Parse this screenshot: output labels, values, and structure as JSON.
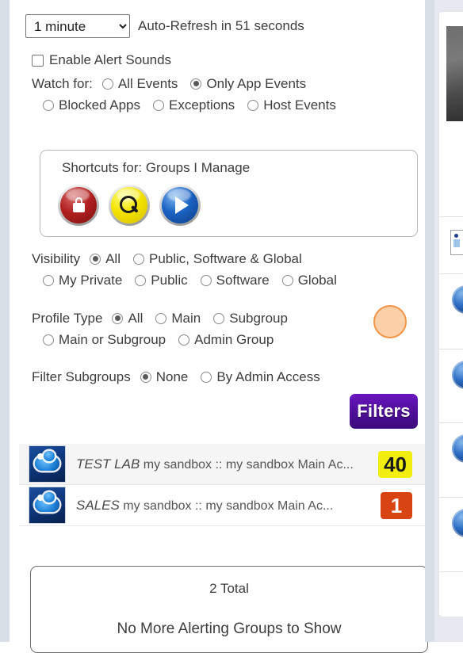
{
  "toolbar": {
    "refresh_interval": "1 minute",
    "refresh_options": [
      "1 minute"
    ],
    "auto_refresh_text": "Auto-Refresh in 51 seconds"
  },
  "alerts": {
    "enable_sounds_label": "Enable Alert Sounds",
    "enable_sounds_checked": false,
    "watch_for_label": "Watch for:",
    "watch_options": [
      {
        "label": "All Events",
        "checked": false
      },
      {
        "label": "Only App Events",
        "checked": true
      },
      {
        "label": "Blocked Apps",
        "checked": false
      },
      {
        "label": "Exceptions",
        "checked": false
      },
      {
        "label": "Host Events",
        "checked": false
      }
    ]
  },
  "shortcuts": {
    "title": "Shortcuts for: Groups I Manage",
    "icons": [
      {
        "name": "lock-icon",
        "color": "#b32020"
      },
      {
        "name": "search-icon",
        "color": "#f3e300"
      },
      {
        "name": "play-icon",
        "color": "#1b63c4"
      }
    ]
  },
  "visibility": {
    "label": "Visibility",
    "options": [
      {
        "label": "All",
        "checked": true
      },
      {
        "label": "Public, Software & Global",
        "checked": false
      },
      {
        "label": "My Private",
        "checked": false
      },
      {
        "label": "Public",
        "checked": false
      },
      {
        "label": "Software",
        "checked": false
      },
      {
        "label": "Global",
        "checked": false
      }
    ]
  },
  "profile_type": {
    "label": "Profile Type",
    "options": [
      {
        "label": "All",
        "checked": true
      },
      {
        "label": "Main",
        "checked": false
      },
      {
        "label": "Subgroup",
        "checked": false
      },
      {
        "label": "Main or Subgroup",
        "checked": false
      },
      {
        "label": "Admin Group",
        "checked": false
      }
    ]
  },
  "filter_subgroups": {
    "label": "Filter Subgroups",
    "options": [
      {
        "label": "None",
        "checked": true
      },
      {
        "label": "By Admin Access",
        "checked": false
      }
    ]
  },
  "filters_button": {
    "label": "Filters",
    "color": "#4d0f96"
  },
  "groups": [
    {
      "name": "TEST LAB",
      "path": "my sandbox :: my sandbox Main Ac...",
      "count": "40",
      "badge_color": "#f2ef10"
    },
    {
      "name": "SALES",
      "path": "my sandbox :: my sandbox Main Ac...",
      "count": "1",
      "badge_color": "#d94413"
    }
  ],
  "footer": {
    "total": "2 Total",
    "message": "No More Alerting Groups to Show"
  }
}
